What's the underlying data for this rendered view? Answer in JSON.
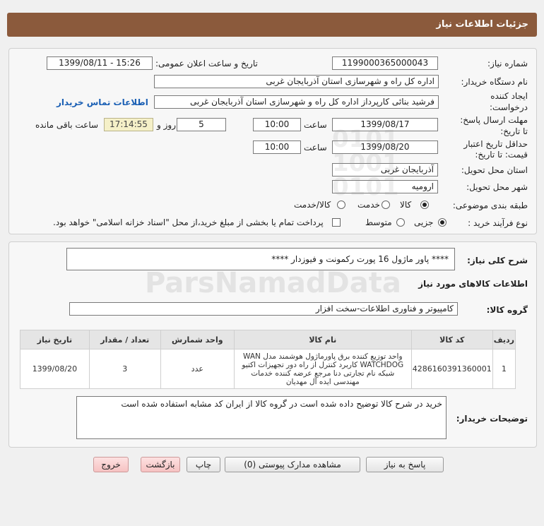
{
  "header": {
    "title": "جزئیات اطلاعات نیاز"
  },
  "form": {
    "need_number_label": "شماره نیاز:",
    "need_number": "1199000365000043",
    "announce_label": "تاریخ و ساعت اعلان عمومی:",
    "announce_value": "1399/08/11 - 15:26",
    "buyer_org_label": "نام دستگاه خریدار:",
    "buyer_org": "اداره کل راه و شهرسازی استان آذربایجان غربی",
    "creator_label_1": "ایجاد کننده",
    "creator_label_2": "درخواست:",
    "creator": "فرشید بنائی کارپرداز اداره کل راه و شهرسازی استان آذربایجان غربی",
    "contact_link": "اطلاعات تماس خریدار",
    "reply_deadline_label_1": "مهلت ارسال پاسخ:",
    "reply_deadline_label_2": "تا تاریخ:",
    "reply_date": "1399/08/17",
    "time_label": "ساعت",
    "reply_time": "10:00",
    "days_value": "5",
    "days_label": "روز و",
    "remaining_time": "17:14:55",
    "remaining_label": "ساعت باقی مانده",
    "validity_label_1": "حداقل تاریخ اعتبار",
    "validity_label_2": "قیمت: تا تاریخ:",
    "validity_date": "1399/08/20",
    "validity_time": "10:00",
    "province_label": "استان محل تحویل:",
    "province": "آذربایجان غربی",
    "city_label": "شهر محل تحویل:",
    "city": "ارومیه",
    "category_label": "طبقه بندی موضوعی:",
    "category_options": [
      "کالا",
      "خدمت",
      "کالا/خدمت"
    ],
    "category_selected": 0,
    "process_label": "نوع فرآیند خرید :",
    "process_options": [
      "جزیی",
      "متوسط"
    ],
    "process_selected": 0,
    "payment_note": "پرداخت تمام یا بخشی از مبلغ خرید،از محل \"اسناد خزانه اسلامی\" خواهد بود."
  },
  "description": {
    "label": "شرح کلی نیاز:",
    "text": "****  پاور ماژول 16 پورت رکمونت و فیوزدار  ****"
  },
  "goods": {
    "section_title": "اطلاعات کالاهای مورد نیاز",
    "group_label": "گروه کالا:",
    "group_value": "کامپیوتر و فناوری اطلاعات-سخت افزار",
    "columns": [
      "ردیف",
      "کد کالا",
      "نام کالا",
      "واحد شمارش",
      "تعداد / مقدار",
      "تاریخ نیاز"
    ],
    "rows": [
      {
        "index": "1",
        "code": "4286160391360001",
        "name": "واحد توزیع کننده برق پاورماژول هوشمند مدل WAN WATCHDOG کاربرد کنترل از راه دور تجهیزات اکتیو شبکه نام تجارتی دنا مرجع عرضه کننده خدمات مهندسی ایده آل مهدیان",
        "unit": "عدد",
        "qty": "3",
        "date": "1399/08/20"
      }
    ]
  },
  "buyer_notes": {
    "label": "توضیحات خریدار:",
    "text": "خرید در شرح کالا توضیح داده شده است در گروه کالا از ایران کد مشابه استفاده شده است"
  },
  "buttons": {
    "reply": "پاسخ به نیاز",
    "docs": "مشاهده مدارک پیوستی (0)",
    "print": "چاپ",
    "back": "بازگشت",
    "exit": "خروج"
  },
  "watermark": {
    "brand": "ParsNamadData",
    "numbers": "0101\n1001\n0101"
  }
}
